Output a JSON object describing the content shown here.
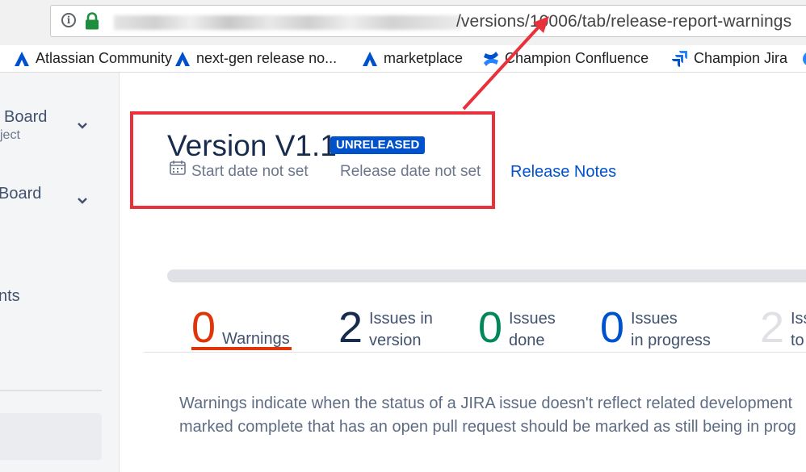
{
  "browser": {
    "url_visible": "/versions/10006/tab/release-report-warnings",
    "bookmarks": [
      {
        "label": "Atlassian Community",
        "icon": "atlassian-icon"
      },
      {
        "label": "next-gen release no...",
        "icon": "atlassian-icon"
      },
      {
        "label": "marketplace",
        "icon": "atlassian-icon"
      },
      {
        "label": "Champion Confluence",
        "icon": "confluence-icon"
      },
      {
        "label": "Champion Jira",
        "icon": "jira-icon"
      }
    ]
  },
  "sidebar": {
    "items": [
      {
        "label": "Board",
        "sublabel": "ject"
      },
      {
        "label": "Board"
      },
      {
        "label": "nts"
      }
    ]
  },
  "version": {
    "title": "Version V1.1",
    "status": "UNRELEASED",
    "start_date": "Start date not set",
    "release_date": "Release date not set",
    "release_notes_link": "Release Notes"
  },
  "stats": [
    {
      "value": "0",
      "label_line1": "Warnings",
      "label_line2": "",
      "color": "#de350b"
    },
    {
      "value": "2",
      "label_line1": "Issues in",
      "label_line2": "version",
      "color": "#172b4d"
    },
    {
      "value": "0",
      "label_line1": "Issues",
      "label_line2": "done",
      "color": "#00875a"
    },
    {
      "value": "0",
      "label_line1": "Issues",
      "label_line2": "in progress",
      "color": "#0052cc"
    },
    {
      "value": "2",
      "label_line1": "Iss",
      "label_line2": "to",
      "color": "#dfe1e6"
    }
  ],
  "description": {
    "line1": "Warnings indicate when the status of a JIRA issue doesn't reflect related development",
    "line2": "marked complete that has an open pull request should be marked as still being in prog"
  },
  "colors": {
    "accent": "#0052cc",
    "annotation": "#e8313a",
    "warning": "#de350b"
  }
}
